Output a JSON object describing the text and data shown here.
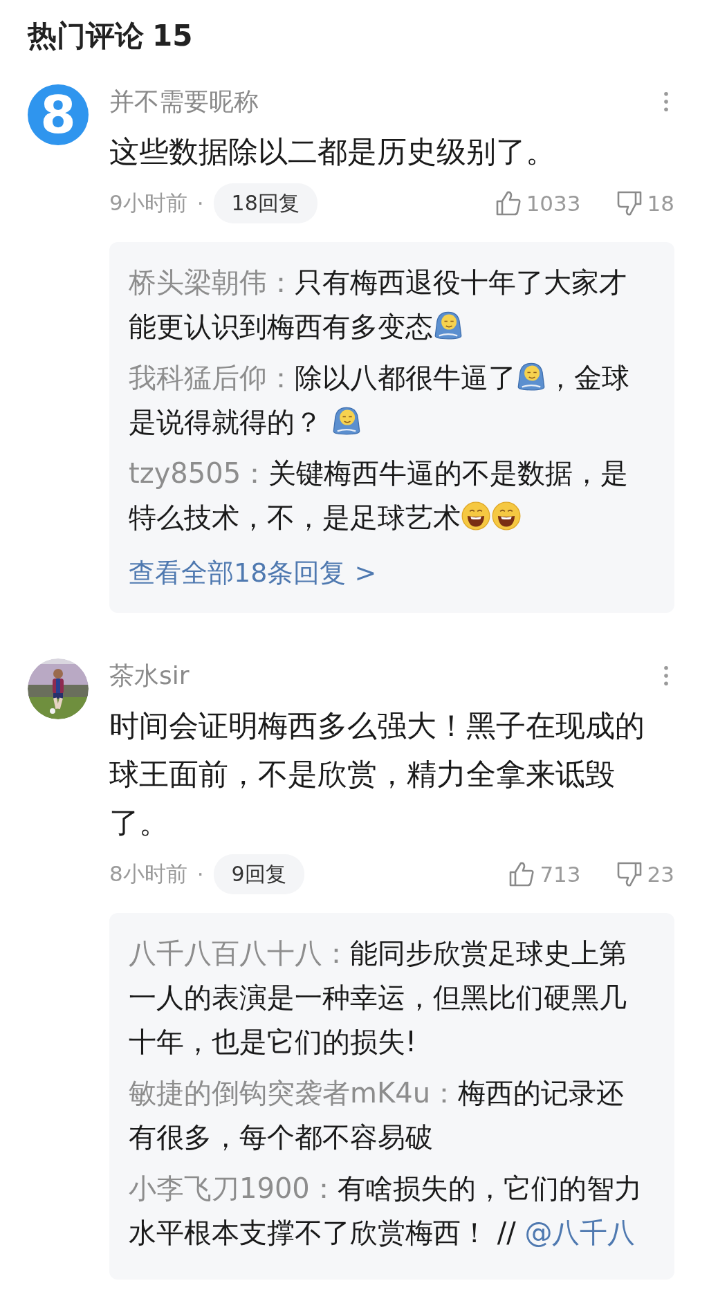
{
  "header": {
    "title": "热门评论",
    "count": "15"
  },
  "comments": [
    {
      "avatar": {
        "kind": "glyph",
        "text": "8"
      },
      "user": "并不需要昵称",
      "text": "这些数据除以二都是历史级别了。",
      "time": "9小时前",
      "separator": "·",
      "replies_button": "18回复",
      "likes": "1033",
      "dislikes": "18",
      "replies": [
        {
          "user": "桥头梁朝伟：",
          "segments": [
            {
              "kind": "text",
              "text": "只有梅西退役十年了大家才能更认识到梅西有多变态"
            },
            {
              "kind": "emoji_shy"
            }
          ]
        },
        {
          "user": "我科猛后仰：",
          "segments": [
            {
              "kind": "text",
              "text": "除以八都很牛逼了"
            },
            {
              "kind": "emoji_shy"
            },
            {
              "kind": "text",
              "text": "，金球是说得就得的？ "
            },
            {
              "kind": "emoji_shy"
            }
          ]
        },
        {
          "user": "tzy8505：",
          "segments": [
            {
              "kind": "text",
              "text": "关键梅西牛逼的不是数据，是特么技术，不，是足球艺术"
            },
            {
              "kind": "emoji_laugh"
            },
            {
              "kind": "emoji_laugh"
            }
          ]
        }
      ],
      "more_link": "查看全部18条回复 >"
    },
    {
      "avatar": {
        "kind": "picture"
      },
      "user": "茶水sir",
      "text": "时间会证明梅西多么强大！黑子在现成的球王面前，不是欣赏，精力全拿来诋毁了。",
      "time": "8小时前",
      "separator": "·",
      "replies_button": "9回复",
      "likes": "713",
      "dislikes": "23",
      "replies": [
        {
          "user": "八千八百八十八：",
          "segments": [
            {
              "kind": "text",
              "text": "能同步欣赏足球史上第一人的表演是一种幸运，但黑比们硬黑几十年，也是它们的损失!"
            }
          ]
        },
        {
          "user": "敏捷的倒钩突袭者mK4u：",
          "segments": [
            {
              "kind": "text",
              "text": "梅西的记录还有很多，每个都不容易破"
            }
          ]
        },
        {
          "user": "小李飞刀1900：",
          "segments": [
            {
              "kind": "text",
              "text": "有啥损失的，它们的智力水平根本支撑不了欣赏梅西！ // "
            },
            {
              "kind": "link",
              "text": "@八千八"
            }
          ]
        }
      ]
    }
  ]
}
